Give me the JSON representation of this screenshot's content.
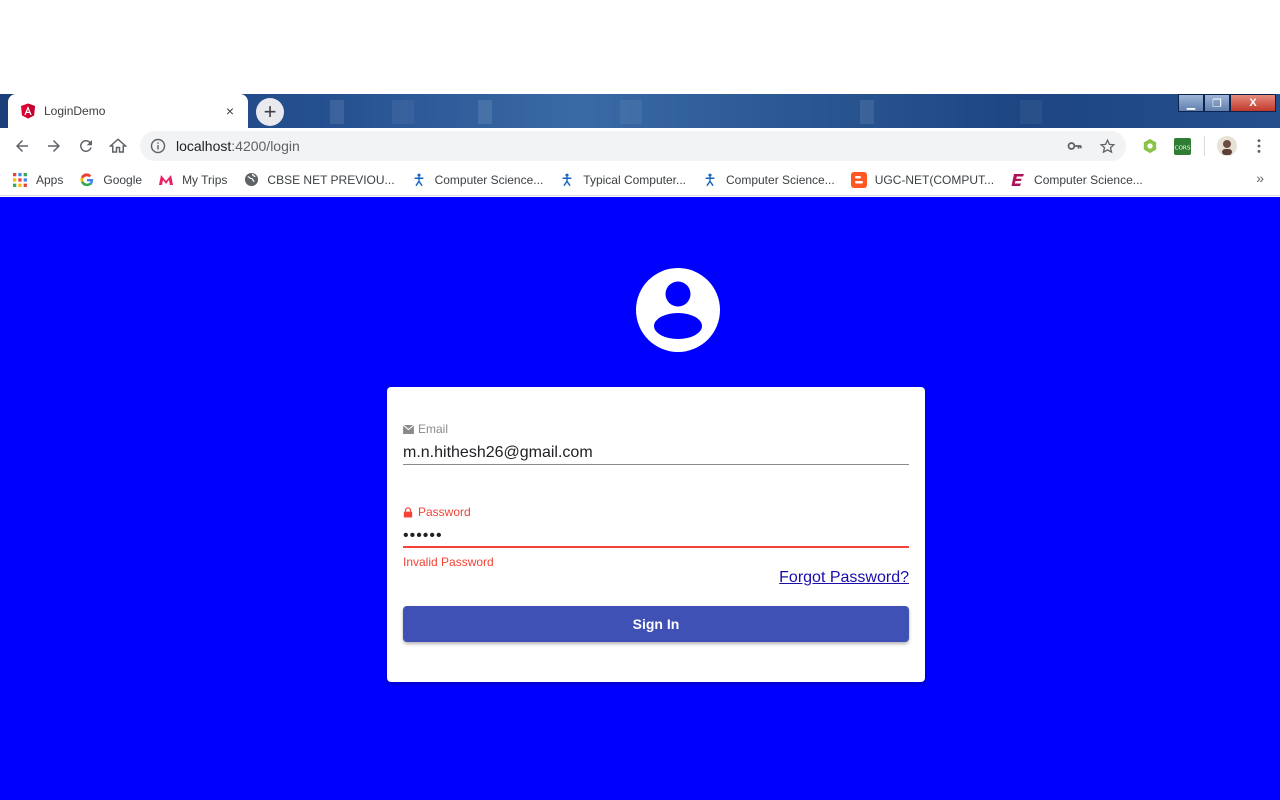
{
  "browser": {
    "tab_title": "LoginDemo",
    "tab_close": "×",
    "new_tab": "+",
    "window_controls": {
      "minimize": "▁",
      "maximize": "❐",
      "close": "X"
    },
    "url_host": "localhost",
    "url_path": ":4200/login",
    "more_bookmarks": "»"
  },
  "bookmarks": [
    {
      "label": "Apps",
      "icon": "apps-grid-icon"
    },
    {
      "label": "Google",
      "icon": "google-icon"
    },
    {
      "label": "My Trips",
      "icon": "mytrips-icon"
    },
    {
      "label": "CBSE NET PREVIOU...",
      "icon": "globe-icon"
    },
    {
      "label": "Computer Science...",
      "icon": "hackerrank-figure-icon"
    },
    {
      "label": "Typical Computer...",
      "icon": "hackerrank-figure-icon"
    },
    {
      "label": "Computer Science...",
      "icon": "hackerrank-figure-icon"
    },
    {
      "label": "UGC-NET(COMPUT...",
      "icon": "blogger-icon"
    },
    {
      "label": "Computer Science...",
      "icon": "e-letter-icon"
    }
  ],
  "login": {
    "email_label": "Email",
    "email_value": "m.n.hithesh26@gmail.com",
    "password_label": "Password",
    "password_value": "••••••",
    "error_text": "Invalid Password",
    "forgot_link": "Forgot Password?",
    "signin_label": "Sign In"
  },
  "colors": {
    "page_bg": "#0000ff",
    "button_bg": "#3f51b5",
    "error": "#f44336",
    "link": "#1a0dab"
  }
}
